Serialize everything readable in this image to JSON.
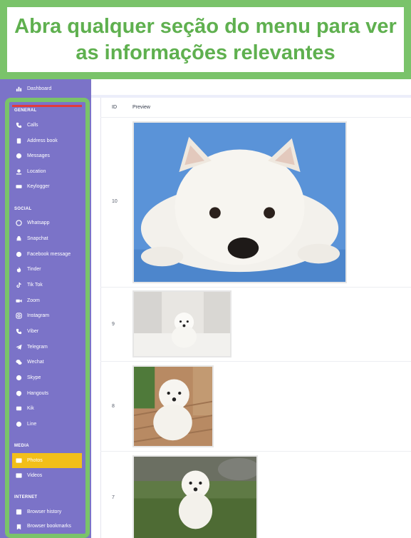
{
  "banner": {
    "text": "Abra qualquer seção do menu para ver as informações relevantes"
  },
  "colors": {
    "sidebar": "#7b73c8",
    "highlight": "#7ac36a",
    "active": "#f2bf19",
    "banner_text": "#5fb04f"
  },
  "sidebar": {
    "dashboard": {
      "label": "Dashboard",
      "icon": "chart-icon"
    },
    "sections": {
      "general": "GENERAL",
      "social": "SOCIAL",
      "media": "MEDIA",
      "internet": "INTERNET"
    },
    "general_items": [
      {
        "label": "Calls",
        "icon": "phone-icon"
      },
      {
        "label": "Address book",
        "icon": "address-book-icon"
      },
      {
        "label": "Messages",
        "icon": "chat-icon"
      },
      {
        "label": "Location",
        "icon": "location-pin-icon"
      },
      {
        "label": "Keylogger",
        "icon": "keyboard-icon"
      }
    ],
    "social_items": [
      {
        "label": "Whatsapp",
        "icon": "whatsapp-icon"
      },
      {
        "label": "Snapchat",
        "icon": "snapchat-icon"
      },
      {
        "label": "Facebook message",
        "icon": "messenger-icon"
      },
      {
        "label": "Tinder",
        "icon": "flame-icon"
      },
      {
        "label": "Tik Tok",
        "icon": "tiktok-icon"
      },
      {
        "label": "Zoom",
        "icon": "video-camera-icon"
      },
      {
        "label": "Instagram",
        "icon": "instagram-icon"
      },
      {
        "label": "Viber",
        "icon": "viber-icon"
      },
      {
        "label": "Telegram",
        "icon": "telegram-icon"
      },
      {
        "label": "Wechat",
        "icon": "wechat-icon"
      },
      {
        "label": "Skype",
        "icon": "skype-icon"
      },
      {
        "label": "Hangouts",
        "icon": "hangouts-icon"
      },
      {
        "label": "Kik",
        "icon": "kik-icon"
      },
      {
        "label": "Line",
        "icon": "line-icon"
      }
    ],
    "media_items": [
      {
        "label": "Photos",
        "icon": "photo-icon",
        "active": true
      },
      {
        "label": "Videos",
        "icon": "film-icon"
      }
    ],
    "internet_items": [
      {
        "label": "Browser history",
        "icon": "history-icon"
      },
      {
        "label": "Browser bookmarks",
        "icon": "bookmark-icon"
      }
    ]
  },
  "table": {
    "columns": [
      "ID",
      "Preview"
    ],
    "rows": [
      {
        "id": "10",
        "preview": "westie-lying-blue-background"
      },
      {
        "id": "9",
        "preview": "westie-sitting-white-room"
      },
      {
        "id": "8",
        "preview": "westie-on-deck"
      },
      {
        "id": "7",
        "preview": "westie-running-grass"
      }
    ]
  }
}
